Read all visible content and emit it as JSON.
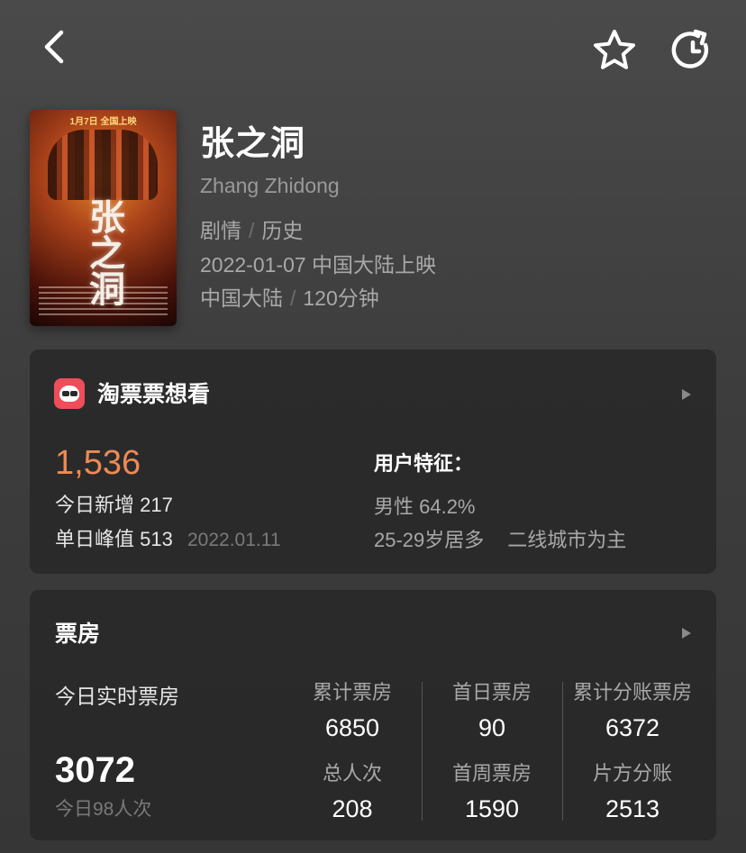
{
  "header": {
    "back_icon": "chevron-left-icon",
    "favorite_icon": "star-outline-icon",
    "share_icon": "share-refresh-icon"
  },
  "movie": {
    "poster_title": "张之洞",
    "poster_top_text": "1月7日 全国上映",
    "title": "张之洞",
    "title_en": "Zhang Zhidong",
    "genres": [
      "剧情",
      "历史"
    ],
    "release": "2022-01-07 中国大陆上映",
    "region": "中国大陆",
    "duration": "120分钟"
  },
  "want_card": {
    "brand_icon": "taopiaopiao-logo-icon",
    "title": "淘票票想看",
    "count": "1,536",
    "today_label": "今日新增",
    "today_value": "217",
    "peak_label": "单日峰值",
    "peak_value": "513",
    "peak_date": "2022.01.11",
    "features_title": "用户特征：",
    "gender": "男性 64.2%",
    "age": "25-29岁居多",
    "city": "二线城市为主"
  },
  "box_card": {
    "title": "票房",
    "realtime_label": "今日实时票房",
    "realtime_value": "3072",
    "realtime_sub": "今日98人次",
    "stats": [
      {
        "label": "累计票房",
        "value": "6850"
      },
      {
        "label": "首日票房",
        "value": "90"
      },
      {
        "label": "累计分账票房",
        "value": "6372"
      },
      {
        "label": "总人次",
        "value": "208"
      },
      {
        "label": "首周票房",
        "value": "1590"
      },
      {
        "label": "片方分账",
        "value": "2513"
      }
    ]
  },
  "colors": {
    "accent_orange": "#ee8a54",
    "taopiaopiao_red": "#ef4d5a",
    "background": "#3d3d3d",
    "card": "#262626"
  }
}
